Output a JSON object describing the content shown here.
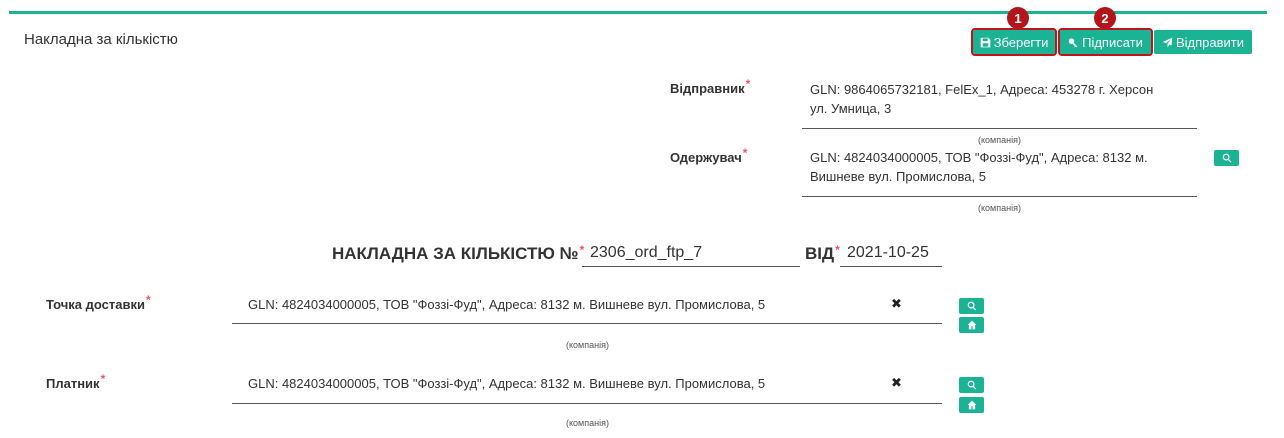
{
  "page": {
    "title": "Накладна за кількістю"
  },
  "toolbar": {
    "save_label": "Зберегти",
    "sign_label": "Підписати",
    "send_label": "Відправити",
    "markers": [
      "1",
      "2"
    ]
  },
  "sender": {
    "label": "Відправник",
    "value_line1": "GLN: 9864065732181, FelEx_1, Адреса: 453278 г. Херсон",
    "value_line2": "ул. Умница, 3",
    "hint": "(компанія)"
  },
  "receiver": {
    "label": "Одержувач",
    "value_line1": "GLN: 4824034000005, ТОВ \"Фоззі-Фуд\", Адреса: 8132 м.",
    "value_line2": "Вишневе вул. Промислова, 5",
    "hint": "(компанія)"
  },
  "document": {
    "heading": "НАКЛАДНА ЗА КІЛЬКІСТЮ №",
    "number": "2306_ord_ftp_7",
    "date_label": "ВІД",
    "date": "2021-10-25"
  },
  "delivery_point": {
    "label": "Точка доставки",
    "value": "GLN: 4824034000005, ТОВ \"Фоззі-Фуд\", Адреса: 8132 м. Вишневе вул. Промислова, 5",
    "hint": "(компанія)"
  },
  "payer": {
    "label": "Платник",
    "value": "GLN: 4824034000005, ТОВ \"Фоззі-Фуд\", Адреса: 8132 м. Вишневе вул. Промислова, 5",
    "hint": "(компанія)"
  },
  "common": {
    "required_mark": "*",
    "clear_glyph": "✖"
  },
  "colors": {
    "accent": "#1ab394",
    "highlight": "#c0131b",
    "required": "#ed5565"
  }
}
